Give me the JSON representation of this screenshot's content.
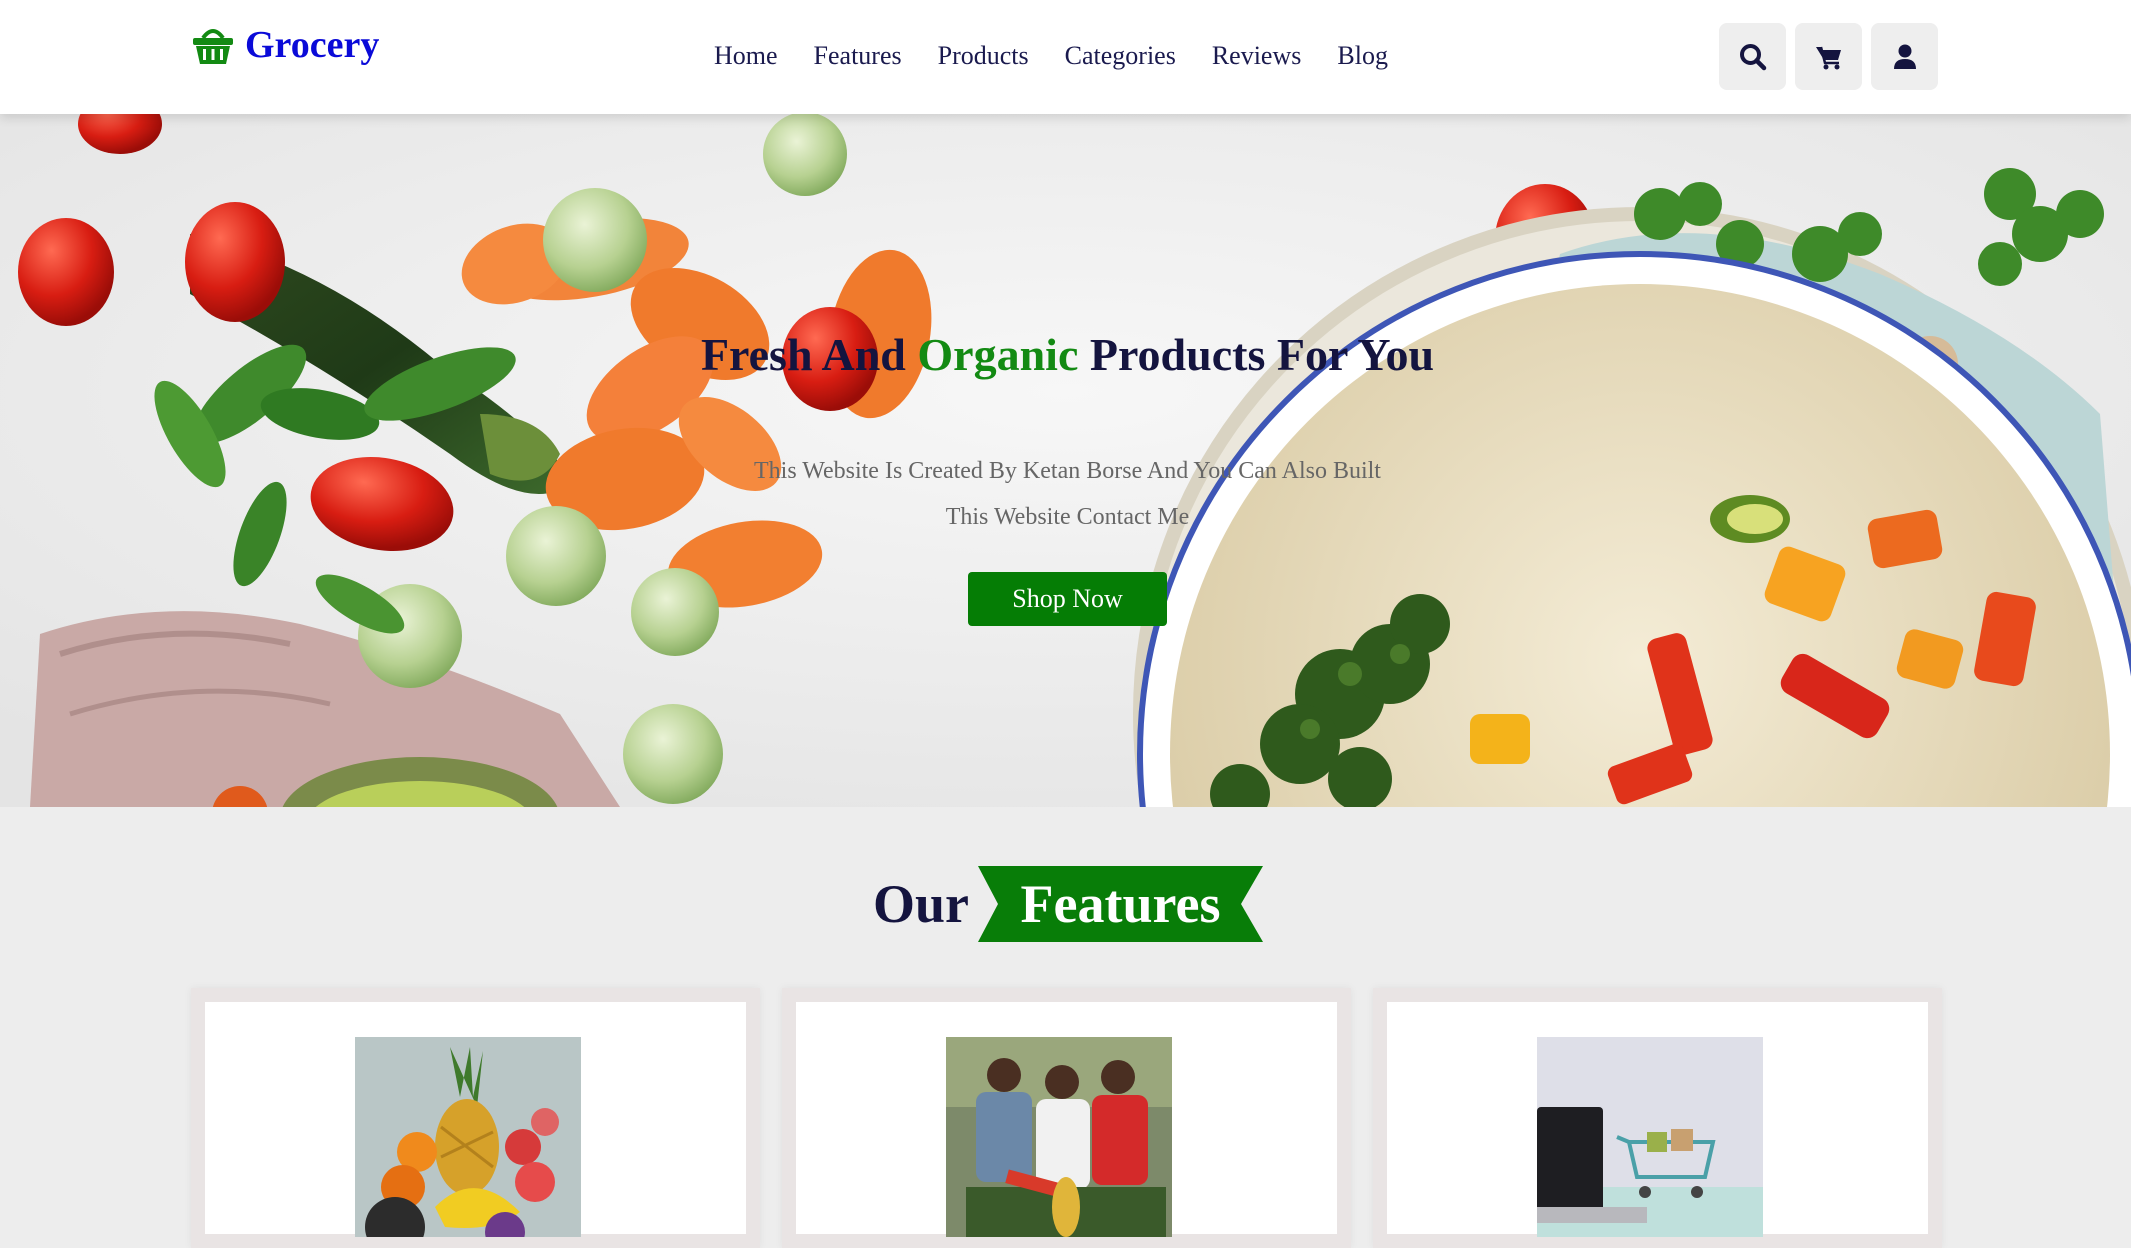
{
  "header": {
    "logo_text": "Grocery",
    "logo_icon": "shopping-basket-icon",
    "nav": [
      {
        "label": "Home"
      },
      {
        "label": "Features"
      },
      {
        "label": "Products"
      },
      {
        "label": "Categories"
      },
      {
        "label": "Reviews"
      },
      {
        "label": "Blog"
      }
    ],
    "icons": [
      "search-icon",
      "cart-icon",
      "user-icon"
    ]
  },
  "hero": {
    "title_before": "Fresh And ",
    "title_accent": "Organic",
    "title_after": " Products For You",
    "description": "This Website Is Created By Ketan Borse And You Can Also Built This Website Contact Me",
    "cta_label": "Shop Now"
  },
  "features": {
    "heading_plain": "Our",
    "heading_highlight": "Features",
    "cards": [
      {
        "image": "fruit-basket-image"
      },
      {
        "image": "delivery-team-image"
      },
      {
        "image": "laptop-shopping-cart-image"
      }
    ]
  },
  "colors": {
    "brand_blue": "#0a0ad8",
    "accent_green": "#138a13",
    "button_green": "#057d05",
    "heading_navy": "#14143f",
    "page_bg": "#ededed"
  }
}
